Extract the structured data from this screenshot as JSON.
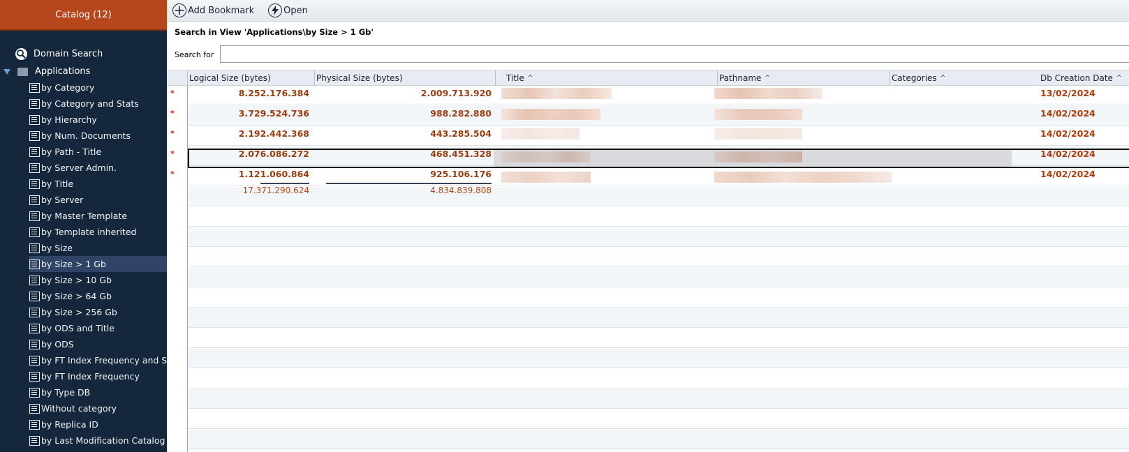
{
  "sidebar": {
    "catalog_title": "Catalog (12)",
    "domain_search": "Domain Search",
    "applications": "Applications",
    "views": [
      "by Category",
      "by Category and Stats",
      "by Hierarchy",
      "by Num. Documents",
      "by Path - Title",
      "by Server Admin.",
      "by Title",
      "by Server",
      "by Master Template",
      "by Template inherited",
      "by Size",
      "by Size > 1 Gb",
      "by Size > 10 Gb",
      "by Size > 64 Gb",
      "by Size > 256 Gb",
      "by ODS and Title",
      "by ODS",
      "by FT Index Frequency and Size",
      "by FT Index Frequency",
      "by Type DB",
      "Without category",
      "by Replica ID",
      "by Last Modification Catalog"
    ],
    "selected_view": "by Size > 1 Gb"
  },
  "toolbar": {
    "add_bookmark": "Add Bookmark",
    "open": "Open"
  },
  "search": {
    "title": "Search in View 'Applications\\by Size > 1 Gb'",
    "label": "Search for",
    "value": ""
  },
  "grid": {
    "columns": {
      "logical": "Logical Size (bytes)",
      "physical": "Physical Size (bytes)",
      "title": "Title",
      "pathname": "Pathname",
      "categories": "Categories",
      "db_creation": "Db Creation Date"
    },
    "rows": [
      {
        "marker": "*",
        "logical": "8.252.176.384",
        "physical": "2.009.713.920",
        "date": "13/02/2024"
      },
      {
        "marker": "*",
        "logical": "3.729.524.736",
        "physical": "988.282.880",
        "date": "14/02/2024"
      },
      {
        "marker": "*",
        "logical": "2.192.442.368",
        "physical": "443.285.504",
        "date": "14/02/2024"
      },
      {
        "marker": "*",
        "logical": "2.076.086.272",
        "physical": "468.451.328",
        "date": "14/02/2024"
      },
      {
        "marker": "*",
        "logical": "1.121.060.864",
        "physical": "925.106.176",
        "date": "14/02/2024"
      }
    ],
    "totals": {
      "logical": "17.371.290.624",
      "physical": "4.834.839.808"
    }
  },
  "colors": {
    "sidebar_bg": "#14273d",
    "catalog_header": "#b5471a",
    "selected_item": "#2f4466",
    "value_text": "#9a3e10",
    "unread_star": "#c0211a"
  }
}
